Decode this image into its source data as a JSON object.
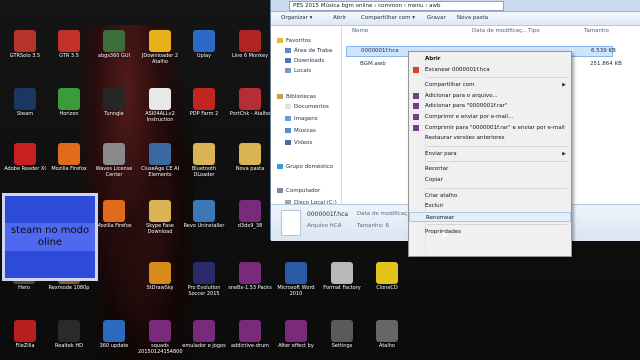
{
  "desktop": {
    "icons": [
      {
        "label": "GTRSolo 3.5",
        "icon": "gtr-icon",
        "color": "#b5342a"
      },
      {
        "label": "GTR 3.5",
        "icon": "gtr-icon",
        "color": "#c2322a"
      },
      {
        "label": "Steam",
        "icon": "steam-icon",
        "color": "#1b3660"
      },
      {
        "label": "Horizon",
        "icon": "horizon-icon",
        "color": "#3b9b3b"
      },
      {
        "label": "Adobe Reader XI",
        "icon": "pdf-icon",
        "color": "#c8201f"
      },
      {
        "label": "Mozilla Firefox",
        "icon": "firefox-icon",
        "color": "#e26b1b"
      },
      {
        "label": "Tunngle",
        "icon": "tunngle-icon",
        "color": "#262626"
      },
      {
        "label": "ASI04ALLv2 Instruction",
        "icon": "doc-icon",
        "color": "#e8e8e8"
      },
      {
        "label": "PDP Farm 2",
        "icon": "pdp-icon",
        "color": "#c0261f"
      },
      {
        "label": "PortChk - Atalho",
        "icon": "portchk-icon",
        "color": "#b52e36"
      },
      {
        "label": "Line 6 Monkey",
        "icon": "monkey-icon",
        "color": "#b02424"
      },
      {
        "label": "Uplay",
        "icon": "uplay-icon",
        "color": "#2b6bc6"
      },
      {
        "label": "Waves License Center",
        "icon": "waves-icon",
        "color": "#8a8a8a"
      },
      {
        "label": "CluseAge CE AI Elements",
        "icon": "app-icon",
        "color": "#3a6aa0"
      },
      {
        "label": "Bluetooth DLoader",
        "icon": "folder-icon",
        "color": "#d9b454"
      },
      {
        "label": "Nova pasta",
        "icon": "folder-icon",
        "color": "#d9b454"
      },
      {
        "label": "abgs360 GUI",
        "icon": "app-icon",
        "color": "#3a6f3a"
      },
      {
        "label": "JDownloader 2 Atalho",
        "icon": "jdownloader-icon",
        "color": "#e8b019"
      },
      {
        "label": "Mozilla Firefox",
        "icon": "firefox-icon",
        "color": "#e26b1b"
      },
      {
        "label": "Skype Fase Download",
        "icon": "folder-icon",
        "color": "#d9b454"
      },
      {
        "label": "Revo Uninstaller",
        "icon": "revo-icon",
        "color": "#3a78b8"
      },
      {
        "label": "d3dx9_38",
        "icon": "archive-icon",
        "color": "#7a2a7a"
      },
      {
        "label": "steam no modo oline",
        "icon": "note-icon",
        "color": "#2d4bd8"
      },
      {
        "label": "Rexmode 1080p",
        "icon": "folder-icon",
        "color": "#7a6330"
      },
      {
        "label": "StDrawSky",
        "icon": "app-icon",
        "color": "#d98b1a"
      },
      {
        "label": "Pro Evolution Soccer 2015",
        "icon": "pes-icon",
        "color": "#2a2a6a"
      },
      {
        "label": "sne8x-1.53 Packs",
        "icon": "archive-icon",
        "color": "#7a2a7a"
      },
      {
        "label": "Microsoft Word 2010",
        "icon": "word-icon",
        "color": "#2a5aa8"
      },
      {
        "label": "Format Factory",
        "icon": "factory-icon",
        "color": "#b8b8b8"
      },
      {
        "label": "CloneCD",
        "icon": "clonecd-icon",
        "color": "#e2c41a"
      },
      {
        "label": "FileZilla",
        "icon": "filezilla-icon",
        "color": "#b8201f"
      },
      {
        "label": "Realtek HD",
        "icon": "realtek-icon",
        "color": "#2a2a2a"
      },
      {
        "label": "360 update",
        "icon": "app-icon",
        "color": "#2a6ac0"
      },
      {
        "label": "squads 20150124154800",
        "icon": "archive-icon",
        "color": "#7a2a7a"
      },
      {
        "label": "emulador e jogos",
        "icon": "archive-icon",
        "color": "#7a2a7a"
      },
      {
        "label": "addictive-drum",
        "icon": "archive-icon",
        "color": "#7a2a7a"
      },
      {
        "label": "After effect by",
        "icon": "archive-icon",
        "color": "#7a2a7a"
      },
      {
        "label": "Settings",
        "icon": "settings-icon",
        "color": "#5a5a5a"
      },
      {
        "label": "Atalho",
        "icon": "app-icon",
        "color": "#666666"
      },
      {
        "label": "Hero",
        "icon": "app-icon",
        "color": "#4a4a4a"
      }
    ]
  },
  "explorer": {
    "path": "PES 2015 Música bgm online › common › menu › awb",
    "toolbar": [
      "Organizar ▾",
      "Abrir",
      "Compartilhar com ▾",
      "Gravar",
      "Nova pasta"
    ],
    "nav": [
      "Favoritos",
      "Área de Traba",
      "Downloads",
      "Locais",
      "Bibliotecas",
      "Documentos",
      "Imagens",
      "Músicas",
      "Vídeos",
      "Grupo doméstico",
      "Computador",
      "Disco Local (C:)"
    ],
    "columns": [
      "Nome",
      "Data de modificaç...",
      "Tipo",
      "Tamanho"
    ],
    "files": [
      {
        "name": "0000001f.hca",
        "size": "6.539 KB",
        "selected": true
      },
      {
        "name": "BGM.awb",
        "size": "251.864 KB",
        "selected": false
      }
    ],
    "details": {
      "name": "0000001f.hca",
      "date_label": "Data de modificaç...: 15/",
      "type": "Arquivo HCA",
      "size_label": "Tamanho: 6"
    }
  },
  "context_menu": {
    "items": [
      {
        "label": "Abrir",
        "bold": true,
        "icon": "",
        "arrow": false
      },
      {
        "label": "Escanear 0000001f.hca",
        "bold": false,
        "icon": "scan-icon",
        "arrow": false
      },
      {
        "sep": true
      },
      {
        "label": "Compartilhar com",
        "bold": false,
        "icon": "",
        "arrow": true
      },
      {
        "label": "Adicionar para o arquivo...",
        "bold": false,
        "icon": "winrar-icon",
        "arrow": false
      },
      {
        "label": "Adicionar para \"0000001f.rar\"",
        "bold": false,
        "icon": "winrar-icon",
        "arrow": false
      },
      {
        "label": "Comprimir e enviar por e-mail...",
        "bold": false,
        "icon": "winrar-icon",
        "arrow": false
      },
      {
        "label": "Comprimir para \"0000001f.rar\" e enviar por e-mail",
        "bold": false,
        "icon": "winrar-icon",
        "arrow": false
      },
      {
        "label": "Restaurar versões anteriores",
        "bold": false,
        "icon": "",
        "arrow": false
      },
      {
        "sep": true
      },
      {
        "label": "Enviar para",
        "bold": false,
        "icon": "",
        "arrow": true
      },
      {
        "sep": true
      },
      {
        "label": "Recortar",
        "bold": false,
        "icon": "",
        "arrow": false
      },
      {
        "label": "Copiar",
        "bold": false,
        "icon": "",
        "arrow": false
      },
      {
        "sep": true
      },
      {
        "label": "Criar atalho",
        "bold": false,
        "icon": "",
        "arrow": false
      },
      {
        "label": "Excluir",
        "bold": false,
        "icon": "",
        "arrow": false
      },
      {
        "label": "Renomear",
        "bold": false,
        "icon": "",
        "arrow": false,
        "hover": true
      },
      {
        "sep": true
      },
      {
        "label": "Propriedades",
        "bold": false,
        "icon": "",
        "arrow": false
      }
    ]
  }
}
